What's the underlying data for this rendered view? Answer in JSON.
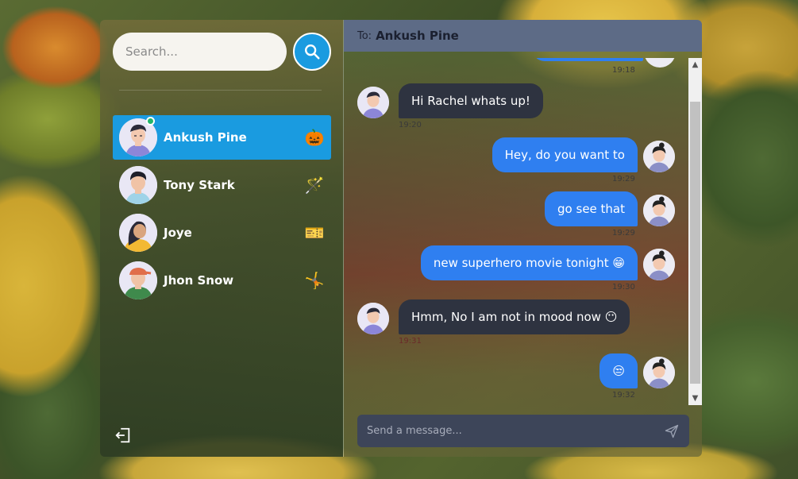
{
  "search": {
    "placeholder": "Search..."
  },
  "contacts": [
    {
      "name": "Ankush Pine",
      "emoji": "🎃",
      "active": true,
      "online": true
    },
    {
      "name": "Tony Stark",
      "emoji": "🪄",
      "active": false,
      "online": false
    },
    {
      "name": "Joye",
      "emoji": "🎫",
      "active": false,
      "online": false
    },
    {
      "name": "Jhon Snow",
      "emoji": "🤸",
      "active": false,
      "online": false
    }
  ],
  "chat": {
    "to_label": "To:",
    "recipient": "Ankush Pine",
    "messages": [
      {
        "direction": "out",
        "text": "",
        "time": "19:18"
      },
      {
        "direction": "in",
        "text": "Hi Rachel whats up!",
        "time": "19:20"
      },
      {
        "direction": "out",
        "text": "Hey, do you want to",
        "time": "19:29"
      },
      {
        "direction": "out",
        "text": "go see that",
        "time": "19:29"
      },
      {
        "direction": "out",
        "text": "new superhero movie tonight 😁",
        "time": "19:30"
      },
      {
        "direction": "in",
        "text": "Hmm, No I am not in mood now 😶",
        "time": "19:31"
      },
      {
        "direction": "out",
        "text": "😒",
        "time": "19:32"
      }
    ],
    "composer_placeholder": "Send a message..."
  },
  "colors": {
    "accent": "#1a9be0",
    "outgoing": "#2f7ff0",
    "incoming": "#2e3340",
    "header": "#5d6b86"
  }
}
